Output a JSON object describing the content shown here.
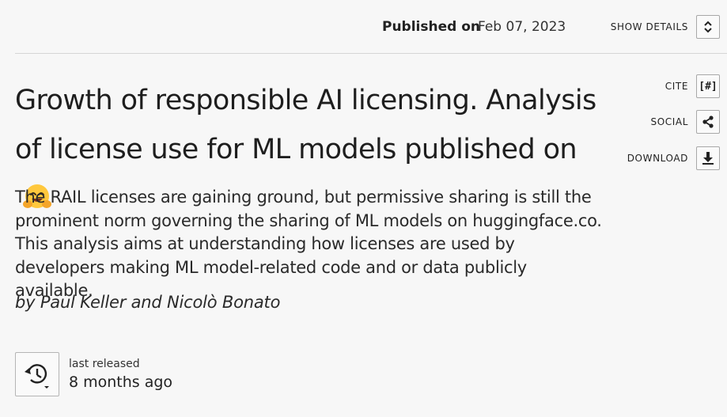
{
  "header": {
    "published_label": "Published on",
    "published_date": "Feb 07, 2023",
    "show_details_label": "SHOW DETAILS",
    "show_details_icon": "chevron-up-down-icon"
  },
  "actions": {
    "cite_label": "CITE",
    "cite_icon_text": "[#]",
    "social_label": "SOCIAL",
    "social_icon": "share-icon",
    "download_label": "DOWNLOAD",
    "download_icon": "download-icon"
  },
  "article": {
    "title": "Growth of responsible AI licensing. Analysis of license use for ML models published on",
    "title_emoji": "hugging-face-emoji",
    "description": "The RAIL licenses are gaining ground, but permissive sharing is still the prominent norm governing the sharing of ML models on huggingface.co. This analysis aims at understanding how licenses are used by developers making ML model-related code and or data publicly available.",
    "byline": "by Paul Keller and Nicolò Bonato"
  },
  "release": {
    "label": "last released",
    "value": "8 months ago",
    "icon": "history-icon"
  }
}
